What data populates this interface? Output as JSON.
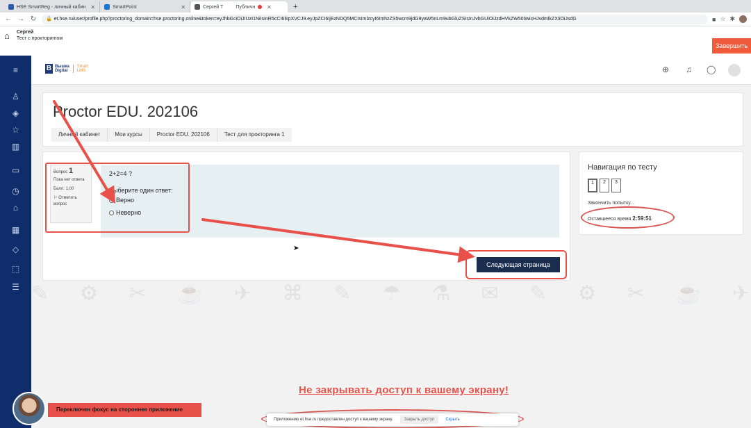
{
  "browser": {
    "tabs": [
      {
        "label": "HSE SmartReg - личный кабин",
        "active": false
      },
      {
        "label": "SmartPoint",
        "active": false
      },
      {
        "label": "Сергей Т",
        "active": true
      },
      {
        "label": "Публичн",
        "active": false
      }
    ],
    "url": "et.hse.ru/user/profile.php?proctoring_domain=hse.proctoring.online&token=eyJhbGciOiJIUzI1NiIsInR5cCI6IkpXVCJ9.eyJpZCI6IjEzNDQ5MCIsImlzcyI6ImhzZS5wcm9jdG9yaW5nLm9ubGluZSIsInJvbGUiOiJzdHVkZW50IiwicHJvdmlkZXIiOiJsdG"
  },
  "proctoring": {
    "user_name": "Сергей",
    "session_title": "Тест с прокторингом",
    "finish_label": "Завершить"
  },
  "header": {
    "logo_line1": "Вышка",
    "logo_line2": "Digital",
    "logo_smart1": "Smart",
    "logo_smart2": "LMS"
  },
  "course": {
    "title": "Proctor EDU. 202106",
    "breadcrumb": [
      "Личный кабинет",
      "Мои курсы",
      "Proctor EDU. 202106",
      "Тест для прокторинга 1"
    ]
  },
  "question": {
    "label": "Вопрос",
    "number": "1",
    "status": "Пока нет ответа",
    "points": "Балл: 1,00",
    "flag_label": "Отметить вопрос",
    "text": "2+2=4 ?",
    "prompt": "Выберите один ответ:",
    "options": [
      "Верно",
      "Неверно"
    ]
  },
  "next_label": "Следующая страница",
  "quiz_nav": {
    "title": "Навигация по тесту",
    "pages": [
      "1",
      "2",
      "3"
    ],
    "finish_attempt": "Закончить попытку...",
    "time_label": "Оставшееся время",
    "time_value": "2:59:51"
  },
  "overlay": {
    "warning": "Не закрывать доступ к вашему экрану!",
    "focus_alert": "Переключен фокус на стороннее приложение"
  },
  "share_bar": {
    "message": "Приложению et.hse.ru предоставлен доступ к вашему экрану.",
    "stop_label": "Закрыть доступ",
    "hide_label": "Скрыть"
  },
  "colors": {
    "sidebar": "#0f2d6b",
    "accent_red": "#e8504a",
    "next_button": "#1a2d4e",
    "question_bg": "#e6f0f3"
  }
}
